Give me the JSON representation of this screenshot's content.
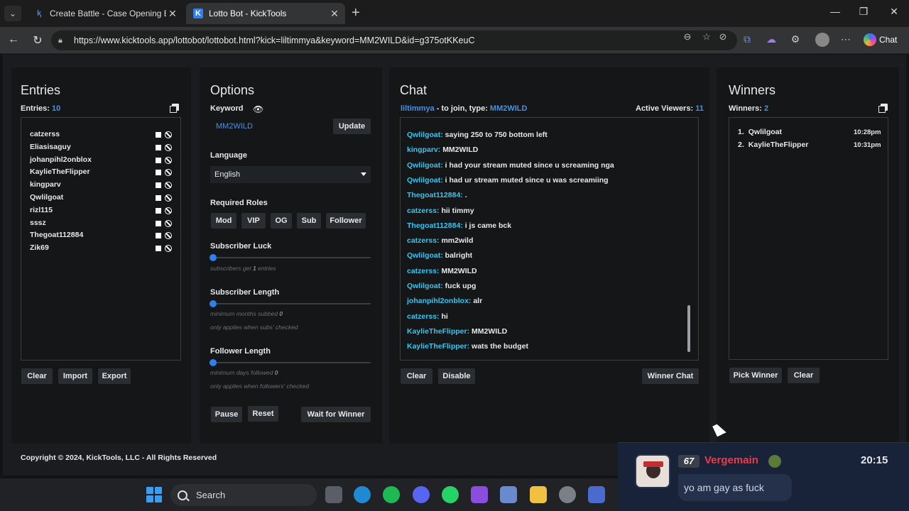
{
  "browser": {
    "tabs": [
      {
        "title": "Create Battle - Case Opening Batt",
        "favicon": "K"
      },
      {
        "title": "Lotto Bot - KickTools",
        "favicon": "K"
      }
    ],
    "url": "https://www.kicktools.app/lottobot/lottobot.html?kick=liltimmya&keyword=MM2WILD&id=g375otKKeuC",
    "chat_label": "Chat"
  },
  "entries": {
    "title": "Entries",
    "count_label": "Entries:",
    "count": "10",
    "list": [
      "catzerss",
      "Eliasisaguy",
      "johanpihl2onblox",
      "KaylieTheFlipper",
      "kingparv",
      "Qwlilgoat",
      "rizl115",
      "sssz",
      "Thegoat112884",
      "Zik69"
    ],
    "buttons": {
      "clear": "Clear",
      "import": "Import",
      "export": "Export"
    }
  },
  "options": {
    "title": "Options",
    "keyword_label": "Keyword",
    "keyword_value": "MM2WILD",
    "update": "Update",
    "language_label": "Language",
    "language_value": "English",
    "roles_label": "Required Roles",
    "roles": [
      "Mod",
      "VIP",
      "OG",
      "Sub",
      "Follower"
    ],
    "sub_luck_label": "Subscriber Luck",
    "sub_luck_hint_pre": "subscribers get",
    "sub_luck_value": "1",
    "sub_luck_hint_post": "entries",
    "sub_length_label": "Subscriber Length",
    "sub_length_hint_pre": "minimum months subbed",
    "sub_length_value": "0",
    "sub_length_note": "only applies when subs' checked",
    "fol_length_label": "Follower Length",
    "fol_length_hint_pre": "minimum days followed",
    "fol_length_value": "0",
    "fol_length_note": "only applies when followers' checked",
    "buttons": {
      "pause": "Pause",
      "reset": "Reset",
      "wait": "Wait for Winner"
    }
  },
  "chat": {
    "title": "Chat",
    "channel": "liltimmya",
    "join_text": "- to join, type:",
    "keyword": "MM2WILD",
    "viewers_label": "Active Viewers:",
    "viewers": "11",
    "messages": [
      {
        "user": "Qwlilgoat:",
        "text": "saying 250 to 750 bottom left"
      },
      {
        "user": "kingparv:",
        "text": "MM2WILD"
      },
      {
        "user": "Qwlilgoat:",
        "text": "i had your stream muted since u screaming nga"
      },
      {
        "user": "Qwlilgoat:",
        "text": "i had ur stream muted since u was screamiing"
      },
      {
        "user": "Thegoat112884:",
        "text": "."
      },
      {
        "user": "catzerss:",
        "text": "hii timmy"
      },
      {
        "user": "Thegoat112884:",
        "text": "i js came bck"
      },
      {
        "user": "catzerss:",
        "text": "mm2wild"
      },
      {
        "user": "Qwlilgoat:",
        "text": "balright"
      },
      {
        "user": "catzerss:",
        "text": "MM2WILD"
      },
      {
        "user": "Qwlilgoat:",
        "text": "fuck upg"
      },
      {
        "user": "johanpihl2onblox:",
        "text": "alr"
      },
      {
        "user": "catzerss:",
        "text": "hi"
      },
      {
        "user": "KaylieTheFlipper:",
        "text": "MM2WILD"
      },
      {
        "user": "KaylieTheFlipper:",
        "text": "wats the budget"
      }
    ],
    "buttons": {
      "clear": "Clear",
      "disable": "Disable",
      "winner_chat": "Winner Chat"
    }
  },
  "winners": {
    "title": "Winners",
    "count_label": "Winners:",
    "count": "2",
    "list": [
      {
        "rank": "1.",
        "name": "Qwlilgoat",
        "time": "10:28pm"
      },
      {
        "rank": "2.",
        "name": "KaylieTheFlipper",
        "time": "10:31pm"
      }
    ],
    "buttons": {
      "pick": "Pick Winner",
      "clear": "Clear"
    }
  },
  "footer": "Copyright © 2024, KickTools, LLC - All Rights Reserved",
  "taskbar": {
    "search": "Search"
  },
  "overlay": {
    "badge": "67",
    "name": "Vergemain",
    "time": "20:15",
    "message": "yo am gay as fuck"
  }
}
